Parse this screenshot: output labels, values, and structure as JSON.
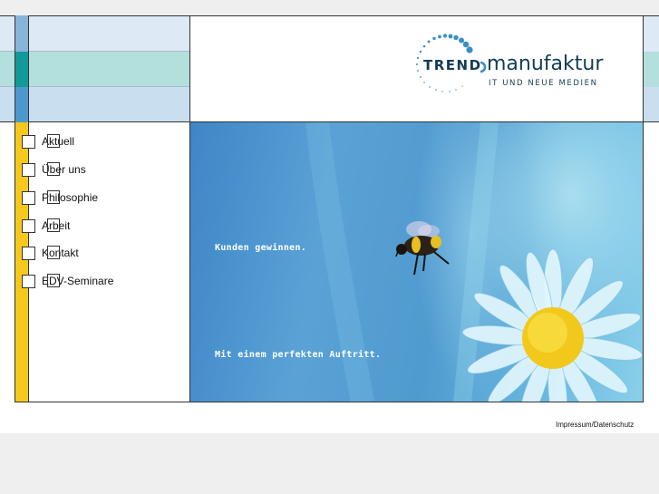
{
  "logo": {
    "brand_left": "TREND",
    "brand_right": "manufaktur",
    "tagline": "IT UND NEUE MEDIEN"
  },
  "nav": {
    "items": [
      {
        "label": "Aktuell"
      },
      {
        "label": "Über uns"
      },
      {
        "label": "Philosophie"
      },
      {
        "label": "Arbeit"
      },
      {
        "label": "Kontakt"
      },
      {
        "label": "EDV-Seminare"
      }
    ]
  },
  "hero": {
    "line1": "Kunden gewinnen.",
    "line2": "Mit einem perfekten Auftritt."
  },
  "footer": {
    "link": "Impressum/Datenschutz"
  },
  "colors": {
    "accent_yellow": "#f5c81e",
    "teal": "#129a98",
    "blue": "#4f98cc",
    "light_blue": "#88b4dc",
    "logo_dark": "#123c55"
  }
}
